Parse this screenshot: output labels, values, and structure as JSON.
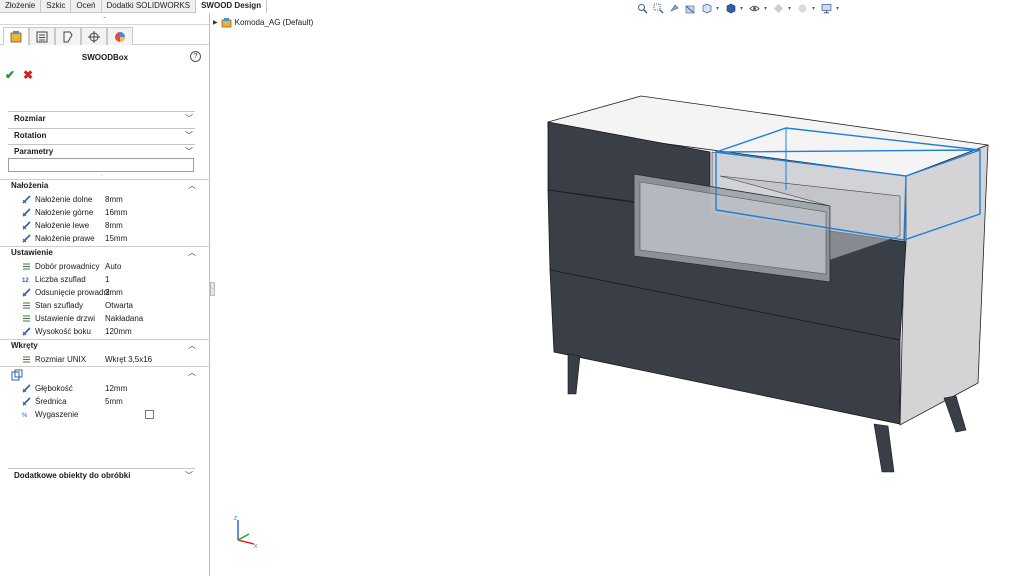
{
  "tabs": [
    "Złożenie",
    "Szkic",
    "Oceń",
    "Dodatki SOLIDWORKS",
    "SWOOD Design"
  ],
  "active_tab": "SWOOD Design",
  "tree": {
    "item_label": "Komoda_AG  (Default)"
  },
  "property_manager": {
    "title": "SWOODBox",
    "help_label": "?",
    "ok_label": "✔",
    "cancel_label": "✖",
    "groups": {
      "rozmiar": "Rozmiar",
      "rotation": "Rotation",
      "parametry": "Parametry",
      "dodatkowe": "Dodatkowe obiekty do obróbki"
    },
    "sections": {
      "nalozenia": {
        "title": "Nałożenia",
        "rows": [
          {
            "label": "Nałożenie dolne",
            "value": "8mm"
          },
          {
            "label": "Nałożenie górne",
            "value": "16mm"
          },
          {
            "label": "Nałożenie lewe",
            "value": "8mm"
          },
          {
            "label": "Nałożenie prawe",
            "value": "15mm"
          }
        ]
      },
      "ustawienie": {
        "title": "Ustawienie",
        "rows": [
          {
            "label": "Dobór prowadnicy",
            "value": "Auto"
          },
          {
            "label": "Liczba szuflad",
            "value": "1"
          },
          {
            "label": "Odsunięcie prowadni",
            "value": "2mm"
          },
          {
            "label": "Stan szuflady",
            "value": "Otwarta"
          },
          {
            "label": "Ustawienie drzwi",
            "value": "Nakładana"
          },
          {
            "label": "Wysokość boku",
            "value": "120mm"
          }
        ]
      },
      "wkrety": {
        "title": "Wkręty",
        "rows": [
          {
            "label": "Rozmiar UNIX",
            "value": "Wkręt 3,5x16"
          }
        ]
      },
      "otwor": {
        "rows": [
          {
            "label": "Głębokość",
            "value": "12mm"
          },
          {
            "label": "Średnica",
            "value": "5mm"
          },
          {
            "label": "Wygaszenie",
            "value": ""
          }
        ]
      }
    }
  },
  "colors": {
    "carcass": "#d4d4d6",
    "front_panels": "#3a3f47",
    "selection_blue": "#1f7fd6",
    "ok_green": "#1f9b2a",
    "cancel_red": "#d22121"
  }
}
